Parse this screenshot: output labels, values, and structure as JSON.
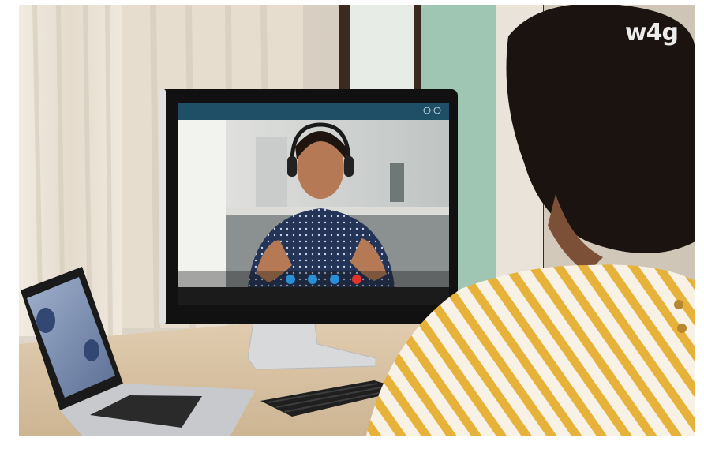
{
  "watermark": {
    "text": "w4g"
  },
  "palette": {
    "wall": "#d9d2c6",
    "curtain": "#ede6db",
    "window_frame": "#3b2a20",
    "window_glass": "#9cc4b2",
    "desk": "#d9c3a6",
    "monitor_bezel": "#111111",
    "video_header": "#1f4f67",
    "call_end": "#e2342f",
    "call_control": "#2b8fd6",
    "shirt_stripe": "#e8b33a",
    "hair": "#1b130f"
  },
  "video_call": {
    "controls": [
      {
        "icon": "camera-icon"
      },
      {
        "icon": "microphone-icon"
      },
      {
        "icon": "chat-icon"
      },
      {
        "icon": "end-call-icon"
      }
    ],
    "window_buttons": [
      {
        "icon": "minimize-icon"
      },
      {
        "icon": "fullscreen-icon"
      }
    ]
  }
}
